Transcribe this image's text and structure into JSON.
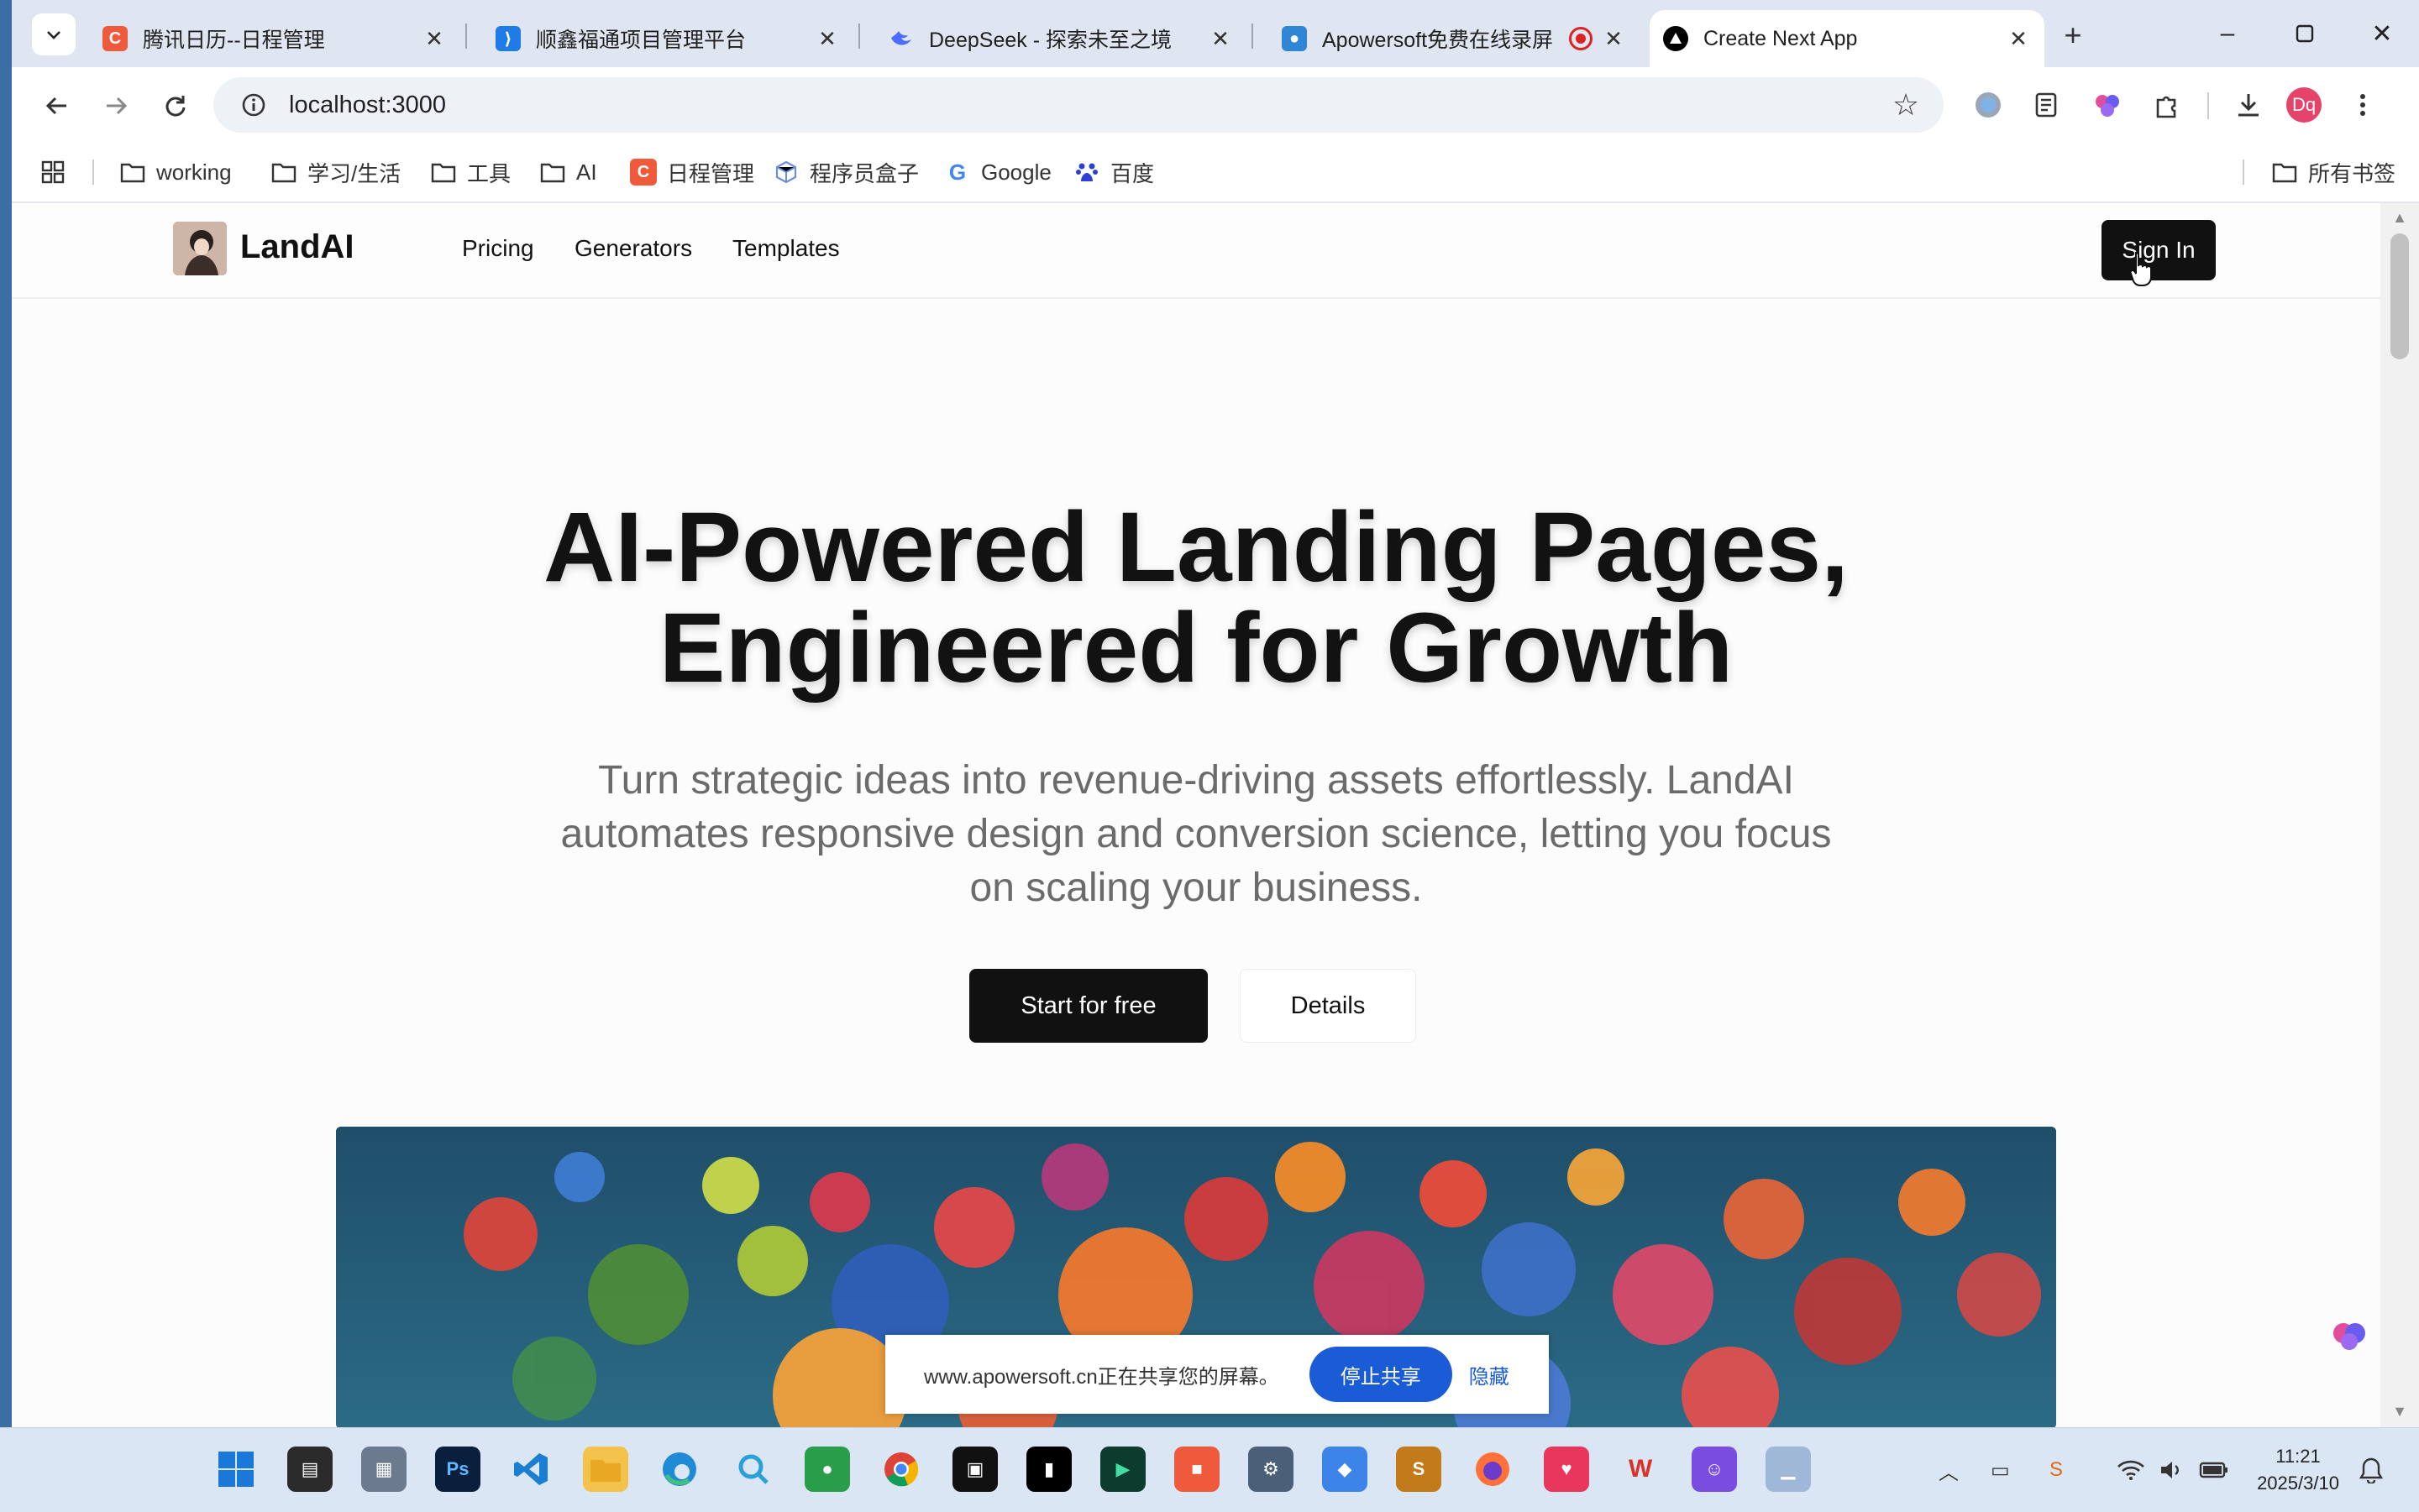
{
  "browser": {
    "tabs": [
      {
        "title": "腾讯日历--日程管理",
        "icon": "tencent-calendar-icon",
        "color": "#f05a3c"
      },
      {
        "title": "顺鑫福通项目管理平台",
        "icon": "project-platform-icon",
        "color": "#1f7be5"
      },
      {
        "title": "DeepSeek - 探索未至之境",
        "icon": "deepseek-icon",
        "color": "#4d6bfe"
      },
      {
        "title": "Apowersoft免费在线录屏",
        "icon": "apowersoft-icon",
        "color": "#2f86d6"
      },
      {
        "title": "Create Next App",
        "icon": "nextjs-icon",
        "color": "#000000",
        "active": true
      }
    ],
    "url": "localhost:3000",
    "profile_initials": "Dq",
    "bookmarks": [
      {
        "label": "working",
        "icon": "folder-icon"
      },
      {
        "label": "学习/生活",
        "icon": "folder-icon"
      },
      {
        "label": "工具",
        "icon": "folder-icon"
      },
      {
        "label": "AI",
        "icon": "folder-icon"
      },
      {
        "label": "日程管理",
        "icon": "tencent-calendar-icon"
      },
      {
        "label": "程序员盒子",
        "icon": "cube-icon"
      },
      {
        "label": "Google",
        "icon": "google-icon"
      },
      {
        "label": "百度",
        "icon": "baidu-icon"
      }
    ],
    "all_bookmarks": "所有书签"
  },
  "site": {
    "brand": "LandAI",
    "nav": [
      "Pricing",
      "Generators",
      "Templates"
    ],
    "sign_in": "Sign In",
    "hero": {
      "title_line1": "AI-Powered Landing Pages,",
      "title_line2": "Engineered for Growth",
      "subtitle": "Turn strategic ideas into revenue-driving assets effortlessly. LandAI automates responsive design and conversion science, letting you focus on scaling your business.",
      "cta_primary": "Start for free",
      "cta_secondary": "Details"
    }
  },
  "share_bar": {
    "text": "www.apowersoft.cn正在共享您的屏幕。",
    "stop": "停止共享",
    "hide": "隐藏"
  },
  "taskbar": {
    "time": "11:21",
    "date": "2025/3/10"
  },
  "colors": {
    "primary": "#111111",
    "share_blue": "#1a5bd6",
    "titlebar": "#dfe6f1"
  }
}
